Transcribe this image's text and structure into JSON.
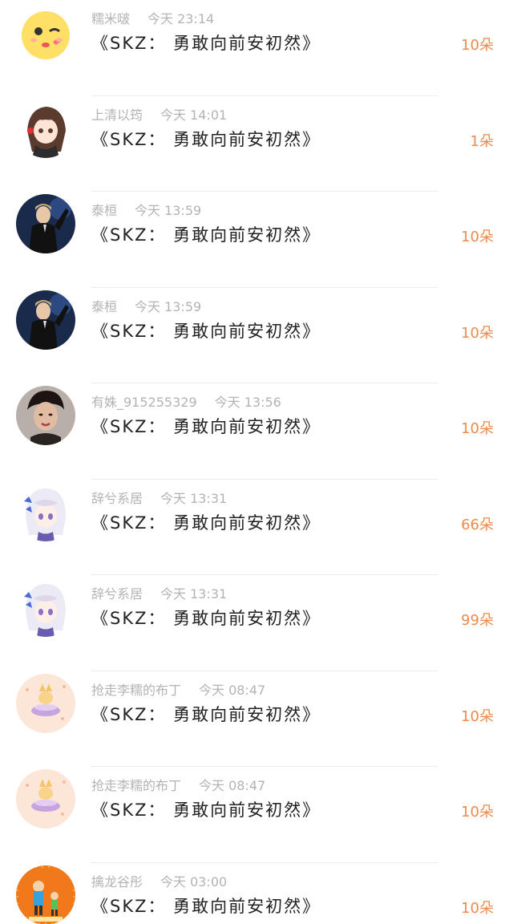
{
  "rows": [
    {
      "user": "糯米啵",
      "time": "今天 23:14",
      "title": "《SKZ： 勇敢向前安初然》",
      "count": "10朵",
      "avatar": "emoji-avatar"
    },
    {
      "user": "上清以筠",
      "time": "今天 14:01",
      "title": "《SKZ： 勇敢向前安初然》",
      "count": "1朵",
      "avatar": "anime-girl-avatar"
    },
    {
      "user": "泰桓",
      "time": "今天 13:59",
      "title": "《SKZ： 勇敢向前安初然》",
      "count": "10朵",
      "avatar": "performer-avatar"
    },
    {
      "user": "泰桓",
      "time": "今天 13:59",
      "title": "《SKZ： 勇敢向前安初然》",
      "count": "10朵",
      "avatar": "performer-avatar"
    },
    {
      "user": "有姝_915255329",
      "time": "今天 13:56",
      "title": "《SKZ： 勇敢向前安初然》",
      "count": "10朵",
      "avatar": "portrait-avatar"
    },
    {
      "user": "辞兮系居",
      "time": "今天 13:31",
      "title": "《SKZ： 勇敢向前安初然》",
      "count": "66朵",
      "avatar": "anime-white-hair-avatar"
    },
    {
      "user": "辞兮系居",
      "time": "今天 13:31",
      "title": "《SKZ： 勇敢向前安初然》",
      "count": "99朵",
      "avatar": "anime-white-hair-avatar"
    },
    {
      "user": "抢走李糯的布丁",
      "time": "今天 08:47",
      "title": "《SKZ： 勇敢向前安初然》",
      "count": "10朵",
      "avatar": "pudding-avatar"
    },
    {
      "user": "抢走李糯的布丁",
      "time": "今天 08:47",
      "title": "《SKZ： 勇敢向前安初然》",
      "count": "10朵",
      "avatar": "pudding-avatar"
    },
    {
      "user": "擒龙谷彤",
      "time": "今天 03:00",
      "title": "《SKZ： 勇敢向前安初然》",
      "count": "10朵",
      "avatar": "cartoon-orange-avatar"
    }
  ],
  "colors": {
    "count": "#f08a4b",
    "meta": "#b3b3b3",
    "title": "#222222",
    "divider": "#ededed"
  }
}
